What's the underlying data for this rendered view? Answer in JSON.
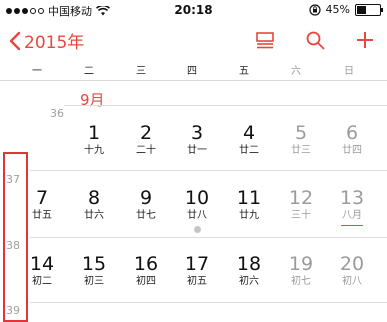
{
  "status_bar": {
    "carrier": "中国移动",
    "time": "20:18",
    "battery_percent": "45%",
    "signal_bars_filled": 3,
    "signal_bars_total": 5,
    "battery_level": 0.45
  },
  "nav": {
    "back_label": "2015年",
    "icons": [
      "list-view-icon",
      "search-icon",
      "add-icon"
    ],
    "accent_color": "#e8473f"
  },
  "weekdays": [
    "一",
    "二",
    "三",
    "四",
    "五",
    "六",
    "日"
  ],
  "calendar": {
    "month_label": "9月",
    "weeks": [
      {
        "week_number": "36",
        "days": [
          {
            "num": "1",
            "lunar": "十九",
            "weekend": false
          },
          {
            "num": "2",
            "lunar": "二十",
            "weekend": false
          },
          {
            "num": "3",
            "lunar": "廿一",
            "weekend": false
          },
          {
            "num": "4",
            "lunar": "廿二",
            "weekend": false
          },
          {
            "num": "5",
            "lunar": "廿三",
            "weekend": true
          },
          {
            "num": "6",
            "lunar": "廿四",
            "weekend": true
          }
        ]
      },
      {
        "week_number": "37",
        "days": [
          {
            "num": "7",
            "lunar": "廿五",
            "weekend": false
          },
          {
            "num": "8",
            "lunar": "廿六",
            "weekend": false
          },
          {
            "num": "9",
            "lunar": "廿七",
            "weekend": false
          },
          {
            "num": "10",
            "lunar": "廿八",
            "weekend": false,
            "has_event": true
          },
          {
            "num": "11",
            "lunar": "廿九",
            "weekend": false
          },
          {
            "num": "12",
            "lunar": "三十",
            "weekend": true
          },
          {
            "num": "13",
            "lunar": "八月",
            "weekend": true,
            "underline": true
          }
        ]
      },
      {
        "week_number": "38",
        "days": [
          {
            "num": "14",
            "lunar": "初二",
            "weekend": false
          },
          {
            "num": "15",
            "lunar": "初三",
            "weekend": false
          },
          {
            "num": "16",
            "lunar": "初四",
            "weekend": false
          },
          {
            "num": "17",
            "lunar": "初五",
            "weekend": false
          },
          {
            "num": "18",
            "lunar": "初六",
            "weekend": false
          },
          {
            "num": "19",
            "lunar": "初七",
            "weekend": true
          },
          {
            "num": "20",
            "lunar": "初八",
            "weekend": true
          }
        ]
      },
      {
        "week_number": "39",
        "days": []
      }
    ]
  }
}
